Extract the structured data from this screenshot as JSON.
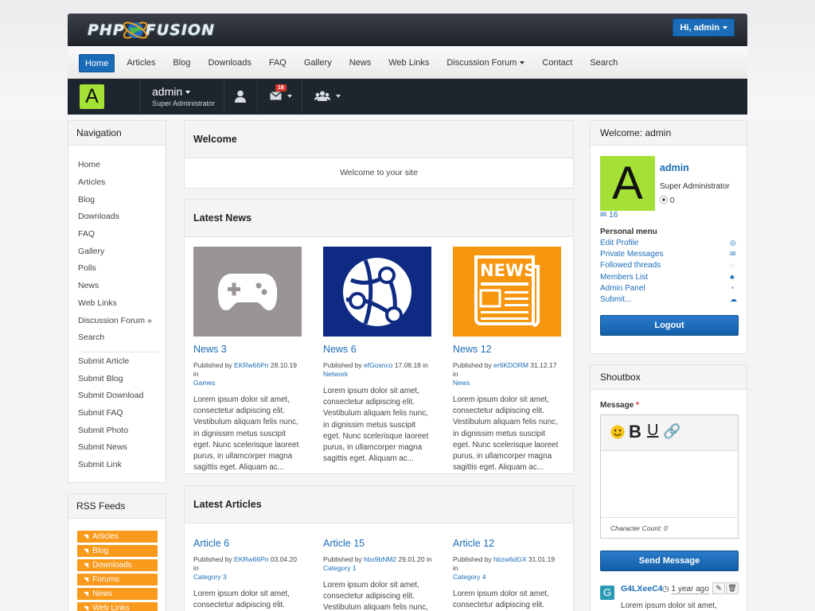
{
  "header": {
    "logo_left": "PHP",
    "logo_right": "FUSION",
    "user_button": "Hi, admin"
  },
  "topnav": {
    "items": [
      "Home",
      "Articles",
      "Blog",
      "Downloads",
      "FAQ",
      "Gallery",
      "News",
      "Web Links",
      "Discussion Forum",
      "Contact",
      "Search"
    ]
  },
  "userbar": {
    "avatar_letter": "A",
    "name": "admin",
    "role": "Super Administrator",
    "messages_badge": "16"
  },
  "left_nav": {
    "title": "Navigation",
    "items": [
      "Home",
      "Articles",
      "Blog",
      "Downloads",
      "FAQ",
      "Gallery",
      "Polls",
      "News",
      "Web Links",
      "Discussion Forum »",
      "Search"
    ],
    "submit_items": [
      "Submit Article",
      "Submit Blog",
      "Submit Download",
      "Submit FAQ",
      "Submit Photo",
      "Submit News",
      "Submit Link"
    ]
  },
  "rss": {
    "title": "RSS Feeds",
    "items": [
      "Articles",
      "Blog",
      "Downloads",
      "Forums",
      "News",
      "Web Links"
    ]
  },
  "welcome": {
    "title": "Welcome",
    "text": "Welcome to your site"
  },
  "latest_news": {
    "title": "Latest News",
    "items": [
      {
        "title": "News 3",
        "published": "Published by",
        "author": "EKRw66Pn",
        "date": "28.10.19 in",
        "category": "Games",
        "body": "Lorem ipsum dolor sit amet, consectetur adipiscing elit. Vestibulum aliquam felis nunc, in dignissim metus suscipit eget. Nunc scelerisque laoreet purus, in ullamcorper magna sagittis eget. Aliquam ac...",
        "thumb_color": "#9a9494"
      },
      {
        "title": "News 6",
        "published": "Published by",
        "author": "efGosnco",
        "date": "17.08.18 in",
        "category": "Network",
        "body": "Lorem ipsum dolor sit amet, consectetur adipiscing elit. Vestibulum aliquam felis nunc, in dignissim metus suscipit eget. Nunc scelerisque laoreet purus, in ullamcorper magna sagittis eget. Aliquam ac...",
        "thumb_color": "#0e2a82"
      },
      {
        "title": "News 12",
        "published": "Published by",
        "author": "er6KDORM",
        "date": "31.12.17 in",
        "category": "News",
        "body": "Lorem ipsum dolor sit amet, consectetur adipiscing elit. Vestibulum aliquam felis nunc, in dignissim metus suscipit eget. Nunc scelerisque laoreet purus, in ullamcorper magna sagittis eget. Aliquam ac...",
        "thumb_color": "#f7960f"
      }
    ]
  },
  "latest_articles": {
    "title": "Latest Articles",
    "items": [
      {
        "title": "Article 6",
        "published": "Published by",
        "author": "EKRw66Pn",
        "date": "03.04.20 in",
        "category": "Category 3",
        "body": "Lorem ipsum dolor sit amet, consectetur adipiscing elit. Vestibulum aliquam felis nunc,"
      },
      {
        "title": "Article 15",
        "published": "Published by",
        "author": "hbx9bNM2",
        "date": "29.01.20 in",
        "category": "Category 1",
        "body": "Lorem ipsum dolor sit amet, consectetur adipiscing elit. Vestibulum aliquam felis nunc,"
      },
      {
        "title": "Article 12",
        "published": "Published by",
        "author": "hbzw6dGX",
        "date": "31.01.19 in",
        "category": "Category 4",
        "body": "Lorem ipsum dolor sit amet, consectetur adipiscing elit. Vestibulum aliquam felis nunc,"
      }
    ]
  },
  "user_panel": {
    "title": "Welcome: admin",
    "avatar_letter": "A",
    "name": "admin",
    "role": "Super Administrator",
    "points": "0",
    "messages": "16",
    "menu_title": "Personal menu",
    "menu": [
      "Edit Profile",
      "Private Messages",
      "Followed threads",
      "Members List",
      "Admin Panel",
      "Submit..."
    ],
    "logout": "Logout"
  },
  "shoutbox": {
    "title": "Shoutbox",
    "message_label": "Message",
    "required_mark": "*",
    "char_count": "Character Count: 0",
    "send": "Send Message",
    "shout_user": "G4LXeeC4",
    "shout_time": "1 year ago",
    "shout_avatar": "G",
    "shout_text": "Lorem ipsum dolor sit amet, consectetur"
  },
  "colors": {
    "accent": "#1b6cb8",
    "rss": "#f99a1c",
    "avatar": "#a4e036",
    "dark": "#1d252e"
  }
}
